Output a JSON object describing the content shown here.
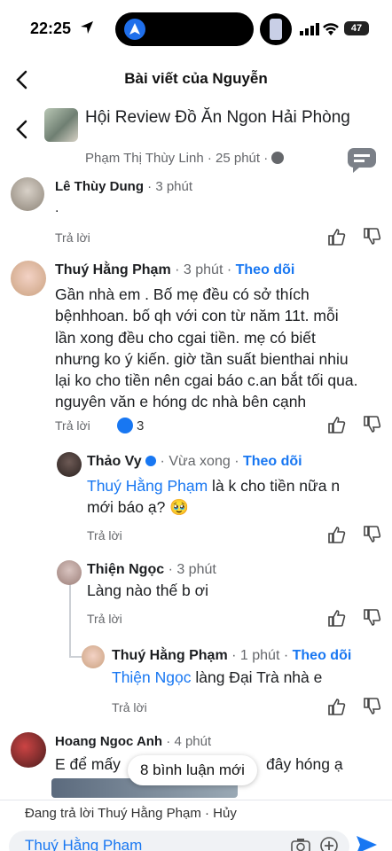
{
  "status": {
    "time": "22:25",
    "battery": "47"
  },
  "header": {
    "title": "Bài viết của Nguyễn"
  },
  "group": {
    "name": "Hội Review Đồ Ăn Ngon Hải Phòng",
    "meta": "Phạm Thị Thùy Linh · 25 phút ·"
  },
  "comments": [
    {
      "name": "Lê Thùy Dung",
      "meta": "· 3 phút",
      "body": ".",
      "reply": "Trả lời"
    },
    {
      "name": "Thuý Hằng Phạm",
      "meta": "· 3 phút ·",
      "follow": "Theo dõi",
      "body_lines": [
        "Gần nhà em . Bố mẹ đều có sở thích",
        "bệnhhoan. bố qh với con từ năm 11t. mỗi",
        "lần xong đều cho cgai tiền. mẹ có biết",
        "nhưng ko ý kiến. giờ tần suất bienthai nhiu",
        "lại ko cho tiền nên cgai báo c.an bắt tối qua.",
        "nguyên văn e hóng dc nhà bên cạnh"
      ],
      "reply": "Trả lời",
      "reactions": "3"
    },
    {
      "name": "Thảo Vy",
      "meta": "· Vừa xong ·",
      "follow": "Theo dõi",
      "mention": "Thuý Hằng Phạm",
      "body_after_mention": " là k cho tiền nữa n",
      "body_line2": "mới báo ạ? 🥹",
      "reply": "Trả lời"
    },
    {
      "name": "Thiện Ngọc",
      "meta": "· 3 phút",
      "body": "Làng nào thế b ơi",
      "reply": "Trả lời"
    },
    {
      "name": "Thuý Hằng Phạm",
      "meta": "· 1 phút ·",
      "follow": "Theo dõi",
      "mention": "Thiện Ngọc",
      "body_after_mention": " làng Đại Trà nhà e",
      "reply": "Trả lời"
    },
    {
      "name": "Hoang Ngoc Anh",
      "meta": "· 4 phút",
      "body_left": "E để mấy",
      "body_right": "đây hóng ạ"
    }
  ],
  "toast": "8 bình luận mới",
  "replying": {
    "label": "Đang trả lời Thuý Hằng Phạm · Hủy",
    "input_value": "Thuý Hằng Phạm"
  },
  "colors": {
    "accent": "#1877f2",
    "meta": "#65676b"
  }
}
